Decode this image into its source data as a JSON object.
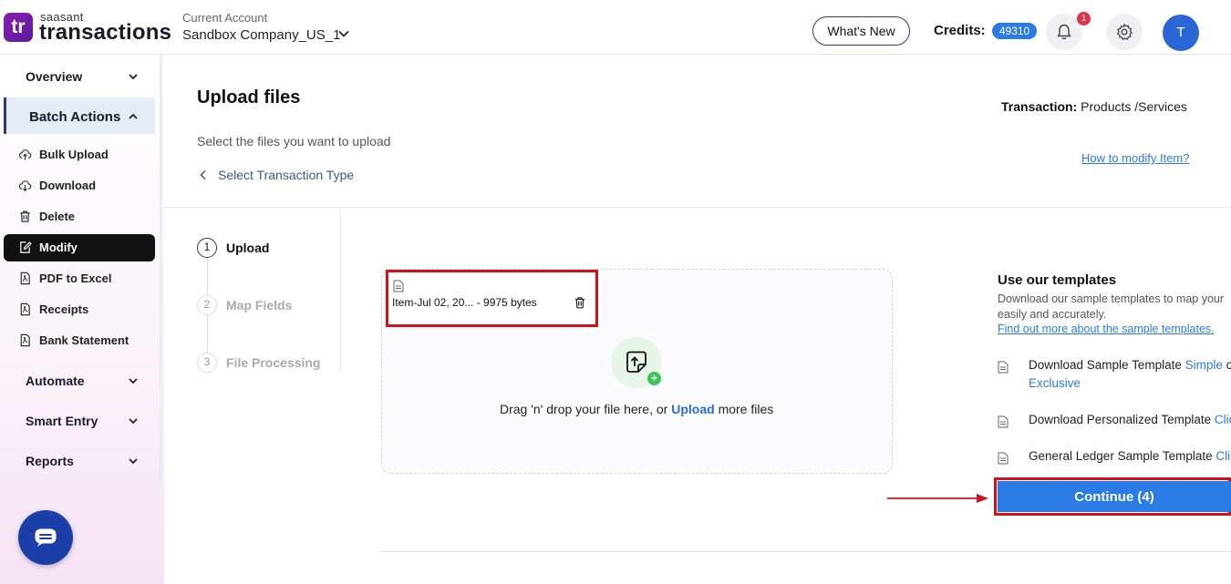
{
  "header": {
    "logo_mark": "tr",
    "brand_small": "saasant",
    "brand_name": "transactions",
    "account_label": "Current Account",
    "account_value": "Sandbox Company_US_1",
    "whats_new": "What's New",
    "credits_label": "Credits:",
    "credits_value": "49310",
    "notification_count": "1",
    "avatar_initial": "T"
  },
  "sidebar": {
    "overview": "Overview",
    "batch_actions": "Batch Actions",
    "items": [
      {
        "label": "Bulk Upload",
        "icon": "cloud-upload-icon"
      },
      {
        "label": "Download",
        "icon": "cloud-download-icon"
      },
      {
        "label": "Delete",
        "icon": "trash-icon"
      },
      {
        "label": "Modify",
        "icon": "edit-icon",
        "active": true
      },
      {
        "label": "PDF to Excel",
        "icon": "pdf-icon"
      },
      {
        "label": "Receipts",
        "icon": "receipt-icon"
      },
      {
        "label": "Bank Statement",
        "icon": "bank-statement-icon"
      }
    ],
    "automate": "Automate",
    "smart_entry": "Smart Entry",
    "reports": "Reports"
  },
  "main": {
    "title": "Upload files",
    "subtitle": "Select the files you want to upload",
    "back_link": "Select Transaction Type",
    "transaction_label": "Transaction:",
    "transaction_value": "Products /Services",
    "how_to_link": "How to modify Item?"
  },
  "steps": [
    {
      "num": "1",
      "label": "Upload",
      "active": true
    },
    {
      "num": "2",
      "label": "Map Fields",
      "active": false
    },
    {
      "num": "3",
      "label": "File Processing",
      "active": false
    }
  ],
  "upload": {
    "file_name": "Item-Jul 02, 20... - 9975 bytes",
    "drop_text_pre": "Drag 'n' drop your file here, or",
    "drop_text_link": "Upload",
    "drop_text_post": "more files",
    "plus": "+"
  },
  "templates": {
    "title": "Use our templates",
    "desc_line1": "Download our sample templates to map your",
    "desc_line2": "easily and accurately.",
    "find_out_link": "Find out more about the sample templates.",
    "row1_text": "Download Sample Template",
    "row1_link1": "Simple",
    "row1_mid": "or",
    "row1_link2": "Exclusive",
    "row2_text": "Download Personalized Template",
    "row2_link": "Click",
    "row3_text": "General Ledger Sample Template",
    "row3_link": "Click"
  },
  "continue_button": "Continue (4)",
  "colors": {
    "accent": "#2a7be4",
    "highlight_red": "#d0121b",
    "nav_dark": "#111111"
  }
}
